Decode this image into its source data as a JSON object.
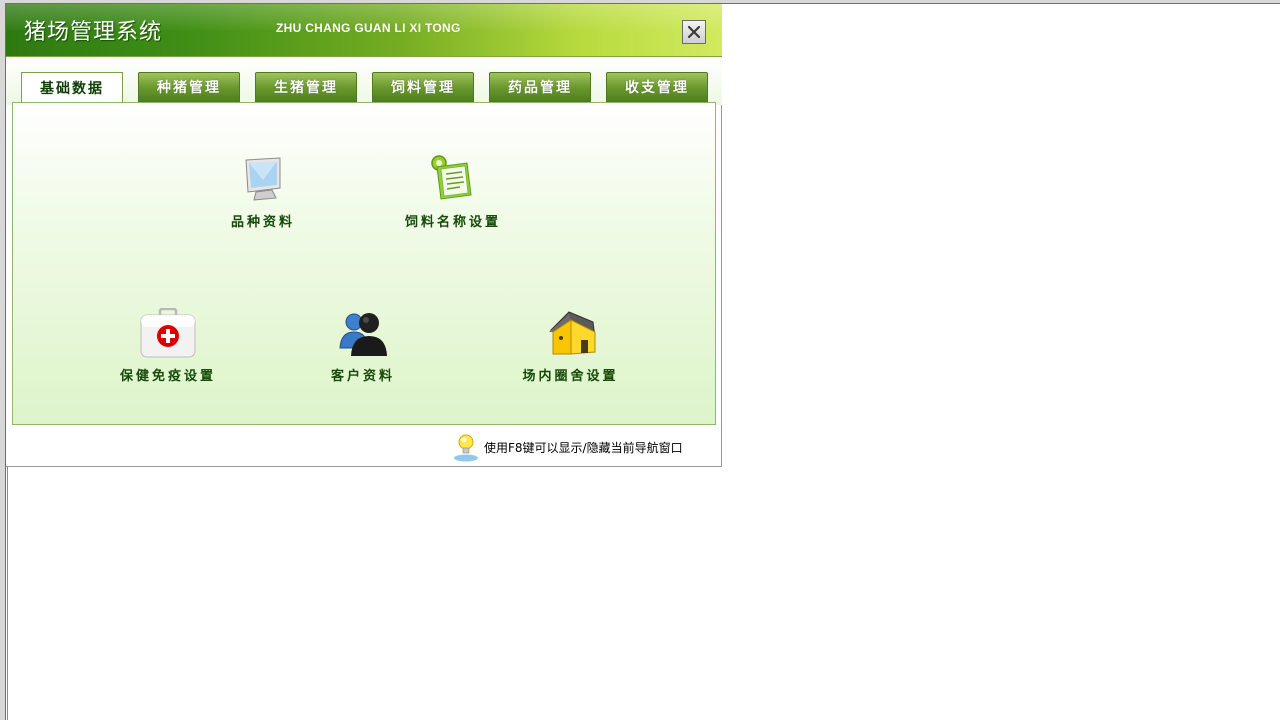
{
  "window": {
    "title_cn": "猪场管理系统",
    "title_en": "ZHU CHANG GUAN LI XI TONG",
    "close_glyph": "✕"
  },
  "tabs": [
    {
      "label": "基础数据",
      "active": true
    },
    {
      "label": "种猪管理",
      "active": false
    },
    {
      "label": "生猪管理",
      "active": false
    },
    {
      "label": "饲料管理",
      "active": false
    },
    {
      "label": "药品管理",
      "active": false
    },
    {
      "label": "收支管理",
      "active": false
    }
  ],
  "items": [
    {
      "label": "品种资料",
      "icon": "monitor-icon"
    },
    {
      "label": "饲料名称设置",
      "icon": "clipboard-gear-icon"
    },
    {
      "label": "保健免疫设置",
      "icon": "first-aid-kit-icon"
    },
    {
      "label": "客户资料",
      "icon": "users-icon"
    },
    {
      "label": "场内圈舍设置",
      "icon": "house-icon"
    }
  ],
  "hint": {
    "text": "使用F8键可以显示/隐藏当前导航窗口",
    "icon": "lightbulb-icon"
  }
}
